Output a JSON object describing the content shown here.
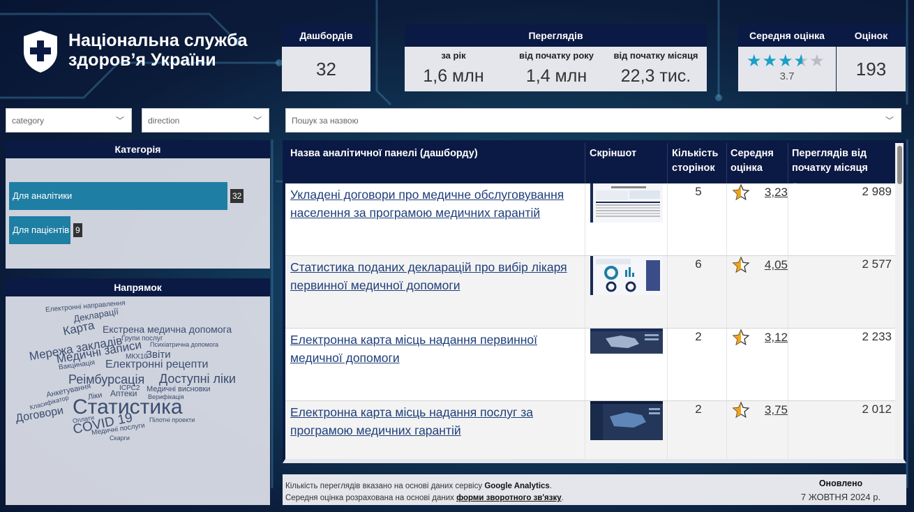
{
  "header": {
    "org_name_line1": "Національна служба",
    "org_name_line2": "здоров’я України"
  },
  "kpis": {
    "dashboards": {
      "label": "Дашбордів",
      "value": "32"
    },
    "views": {
      "label": "Переглядів",
      "year": {
        "label": "за рік",
        "value": "1,6 млн"
      },
      "ytd": {
        "label": "від початку року",
        "value": "1,4 млн"
      },
      "mtd": {
        "label": "від початку місяця",
        "value": "22,3 тис."
      }
    },
    "avg_rating": {
      "label": "Середня оцінка",
      "value": "3.7",
      "stars": 3.7,
      "star_color": "#1b9fc7"
    },
    "ratings_count": {
      "label": "Оцінок",
      "value": "193"
    }
  },
  "filters": {
    "category_placeholder": "category",
    "direction_placeholder": "direction",
    "search_placeholder": "Пошук за назвою"
  },
  "category_panel": {
    "title": "Категорія",
    "bars": [
      {
        "label": "Для аналітики",
        "value": 32
      },
      {
        "label": "Для пацієнтів",
        "value": 9
      }
    ],
    "bar_color": "#1f7ea3"
  },
  "direction_panel": {
    "title": "Напрямок",
    "words": [
      "Електронні направлення",
      "Декларації",
      "Карта",
      "Екстрена медична допомога",
      "Мережа закладів",
      "Групи послуг",
      "Медичні записи",
      "Психіатрична допомога",
      "Вакцинація",
      "МКХ10",
      "Звіти",
      "Електронні рецепти",
      "Реімбурсація",
      "Доступні ліки",
      "Анкетування",
      "ICPC2",
      "Медичні висновки",
      "Ліки",
      "Аптеки",
      "Верифікація",
      "Класифікатор",
      "Статистика",
      "Договори",
      "Оплати",
      "COVID 19",
      "Пілотні проекти",
      "Медичні послуги",
      "Скарги"
    ]
  },
  "table": {
    "headers": {
      "name": "Назва аналітичної панелі (дашборду)",
      "screenshot": "Скріншот",
      "pages_1": "Кількість",
      "pages_2": "сторінок",
      "rating_1": "Середня",
      "rating_2": "оцінка",
      "views_1": "Переглядів від",
      "views_2": "початку місяця"
    },
    "rows": [
      {
        "name": "Укладені договори про медичне обслуговування населення за програмою медичних гарантій",
        "pages": "5",
        "rating": "3,23",
        "views": "2 989"
      },
      {
        "name": "Статистика поданих декларацій про вибір лікаря первинної медичної допомоги",
        "pages": "6",
        "rating": "4,05",
        "views": "2 577"
      },
      {
        "name": "Електронна карта місць надання первинної медичної допомоги",
        "pages": "2",
        "rating": "3,12",
        "views": "2 233"
      },
      {
        "name": "Електронна карта місць надання послуг за програмою медичних гарантій",
        "pages": "2",
        "rating": "3,75",
        "views": "2 012"
      }
    ]
  },
  "footer": {
    "line1_prefix": "Кількість переглядів вказано на основі даних сервісу ",
    "line1_bold": "Google Analytics",
    "line1_suffix": ".",
    "line2_prefix": "Середня оцінка розрахована на основі даних ",
    "line2_link": "форми зворотного зв'язку",
    "line2_suffix": ".",
    "updated_label": "Оновлено",
    "updated_date": "7 ЖОВТНЯ 2024 р."
  }
}
